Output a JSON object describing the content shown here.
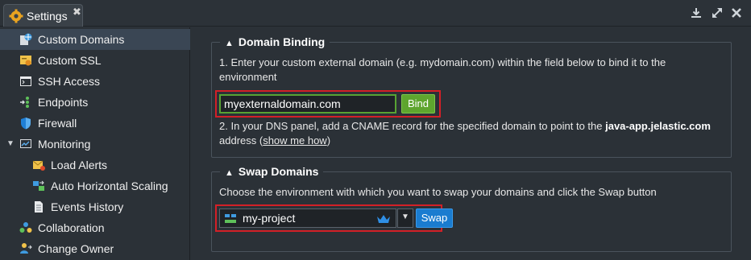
{
  "window": {
    "tab_title": "Settings",
    "tab_close": "✖",
    "controls": [
      "download-icon",
      "expand-icon",
      "close-icon"
    ]
  },
  "sidebar": {
    "items": [
      {
        "label": "Custom Domains",
        "icon": "domains-icon",
        "active": true
      },
      {
        "label": "Custom SSL",
        "icon": "ssl-certificate-icon"
      },
      {
        "label": "SSH Access",
        "icon": "terminal-icon"
      },
      {
        "label": "Endpoints",
        "icon": "endpoints-icon"
      },
      {
        "label": "Firewall",
        "icon": "shield-icon"
      },
      {
        "label": "Monitoring",
        "icon": "monitoring-icon",
        "expanded": true,
        "caret": "▼"
      },
      {
        "label": "Load Alerts",
        "icon": "alert-envelope-icon",
        "child": true
      },
      {
        "label": "Auto Horizontal Scaling",
        "icon": "scaling-icon",
        "child": true
      },
      {
        "label": "Events History",
        "icon": "document-icon",
        "child": true
      },
      {
        "label": "Collaboration",
        "icon": "collaboration-icon"
      },
      {
        "label": "Change Owner",
        "icon": "change-owner-icon"
      }
    ]
  },
  "domain_binding": {
    "title": "Domain Binding",
    "step1": "1. Enter your custom external domain (e.g. mydomain.com) within the field below to bind it to the environment",
    "step1_line1": "1. Enter your custom external domain (e.g. mydomain.com) within the field below to bind it to the",
    "step1_line2": "environment",
    "domain_value": "myexternaldomain.com",
    "bind_label": "Bind",
    "step2_prefix": "2. In your DNS panel, add a CNAME record for the specified domain to point to the",
    "step2_domain": "java-app.jelastic.com",
    "step2_suffix_a": "address (",
    "step2_link": "show me how",
    "step2_suffix_b": ")"
  },
  "swap_domains": {
    "title": "Swap Domains",
    "description": "Choose the environment with which you want to swap your domains and click the Swap button",
    "environment": "my-project",
    "swap_label": "Swap"
  },
  "colors": {
    "background": "#2b3137",
    "active_item": "#3a4654",
    "highlight_box": "#d32027",
    "bind_button": "#5ea52e",
    "swap_button": "#1a7cd0"
  }
}
